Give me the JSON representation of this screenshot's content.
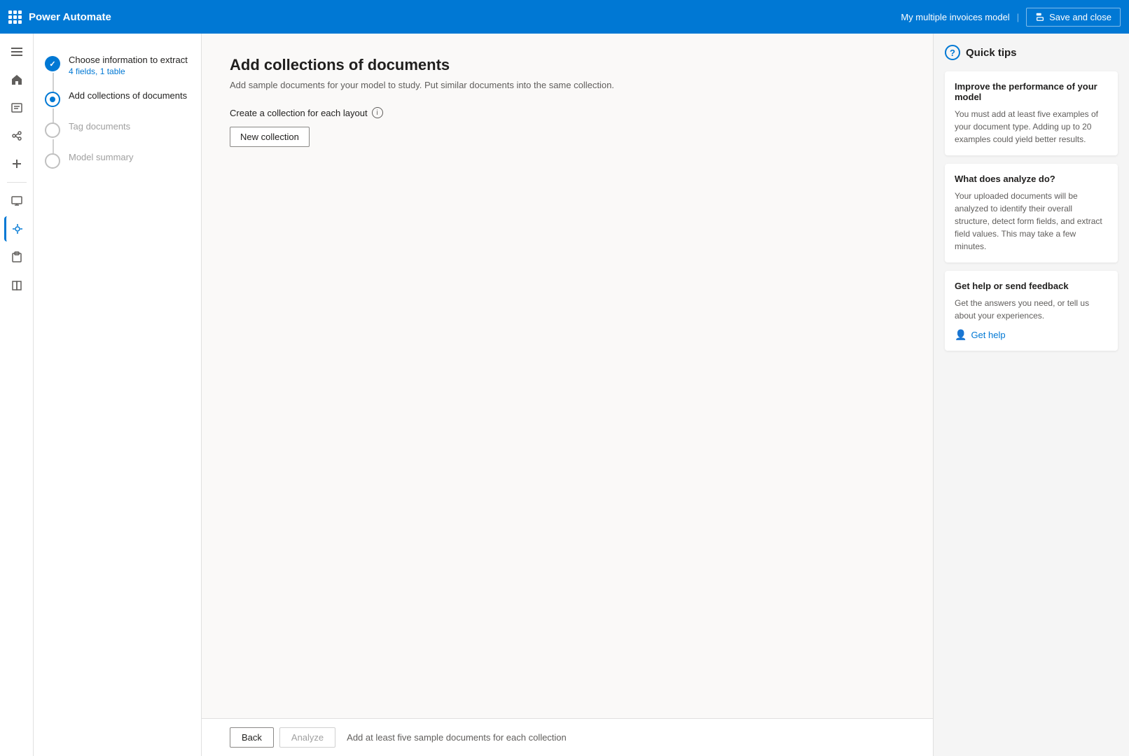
{
  "topbar": {
    "apps_label": "apps",
    "title": "Power Automate",
    "model_name": "My multiple invoices model",
    "separator": "|",
    "save_close_label": "Save and close"
  },
  "nav": {
    "icons": [
      {
        "name": "hamburger-menu",
        "symbol": "☰"
      },
      {
        "name": "home-icon",
        "symbol": "⌂"
      },
      {
        "name": "activity-icon",
        "symbol": "📋"
      },
      {
        "name": "connections-icon",
        "symbol": "⚡"
      },
      {
        "name": "add-icon",
        "symbol": "+"
      },
      {
        "name": "ai-models-icon",
        "symbol": "🧠"
      },
      {
        "name": "monitor-icon",
        "symbol": "📊"
      },
      {
        "name": "flows-icon",
        "symbol": "🔀"
      },
      {
        "name": "docs-icon",
        "symbol": "📄"
      },
      {
        "name": "learn-icon",
        "symbol": "📚"
      }
    ]
  },
  "wizard": {
    "steps": [
      {
        "id": "step-1",
        "title": "Choose information to extract",
        "subtitle": "4 fields, 1 table",
        "status": "completed"
      },
      {
        "id": "step-2",
        "title": "Add collections of documents",
        "subtitle": "",
        "status": "active"
      },
      {
        "id": "step-3",
        "title": "Tag documents",
        "subtitle": "",
        "status": "inactive"
      },
      {
        "id": "step-4",
        "title": "Model summary",
        "subtitle": "",
        "status": "inactive"
      }
    ]
  },
  "content": {
    "page_title": "Add collections of documents",
    "page_subtitle": "Add sample documents for your model to study. Put similar documents into the same collection.",
    "section_label": "Create a collection for each layout",
    "new_collection_label": "New collection"
  },
  "footer": {
    "back_label": "Back",
    "analyze_label": "Analyze",
    "hint": "Add at least five sample documents for each collection"
  },
  "quick_tips": {
    "title": "Quick tips",
    "tips": [
      {
        "title": "Improve the performance of your model",
        "text": "You must add at least five examples of your document type. Adding up to 20 examples could yield better results."
      },
      {
        "title": "What does analyze do?",
        "text": "Your uploaded documents will be analyzed to identify their overall structure, detect form fields, and extract field values. This may take a few minutes."
      },
      {
        "title": "Get help or send feedback",
        "text": "Get the answers you need, or tell us about your experiences."
      }
    ],
    "get_help_label": "Get help"
  }
}
